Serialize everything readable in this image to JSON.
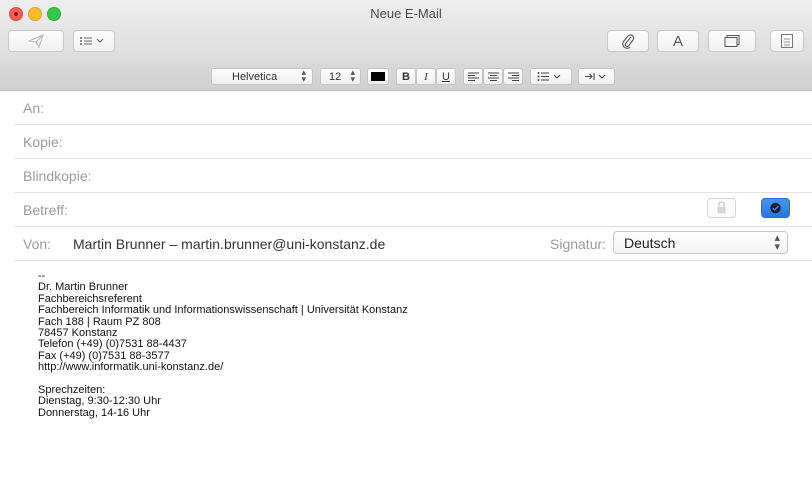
{
  "window": {
    "title": "Neue E-Mail"
  },
  "toolbar": {
    "send_icon": "send-paperplane-icon",
    "header_options_icon": "list-dropdown-icon",
    "attach_icon": "paperclip-icon",
    "format_label": "A",
    "browser_icon": "photo-browser-icon",
    "stationery_icon": "stationery-icon"
  },
  "format": {
    "font": "Helvetica",
    "size": "12",
    "bold": "B",
    "italic": "I",
    "underline": "U",
    "text_color": "#000000"
  },
  "fields": {
    "to_label": "An:",
    "cc_label": "Kopie:",
    "bcc_label": "Blindkopie:",
    "subject_label": "Betreff:",
    "from_label": "Von:",
    "from_value": "Martin Brunner – martin.brunner@uni-konstanz.de",
    "signature_label": "Signatur:",
    "signature_value": "Deutsch"
  },
  "signature": {
    "dash": "--",
    "lines": [
      "Dr. Martin Brunner",
      "Fachbereichsreferent",
      "Fachbereich Informatik und Informationswissenschaft | Universität Konstanz",
      "Fach 188 | Raum PZ 808",
      "78457 Konstanz",
      "Telefon (+49) (0)7531 88-4437",
      "Fax (+49) (0)7531 88-3577",
      "http://www.informatik.uni-konstanz.de/"
    ],
    "hours_title": "Sprechzeiten:",
    "hours": [
      "Dienstag, 9:30-12:30 Uhr",
      "Donnerstag, 14-16 Uhr"
    ]
  },
  "colors": {
    "accent": "#2a74dc",
    "close": "#fc5f57",
    "minimize": "#fdbc2e",
    "zoom": "#34c84a"
  }
}
